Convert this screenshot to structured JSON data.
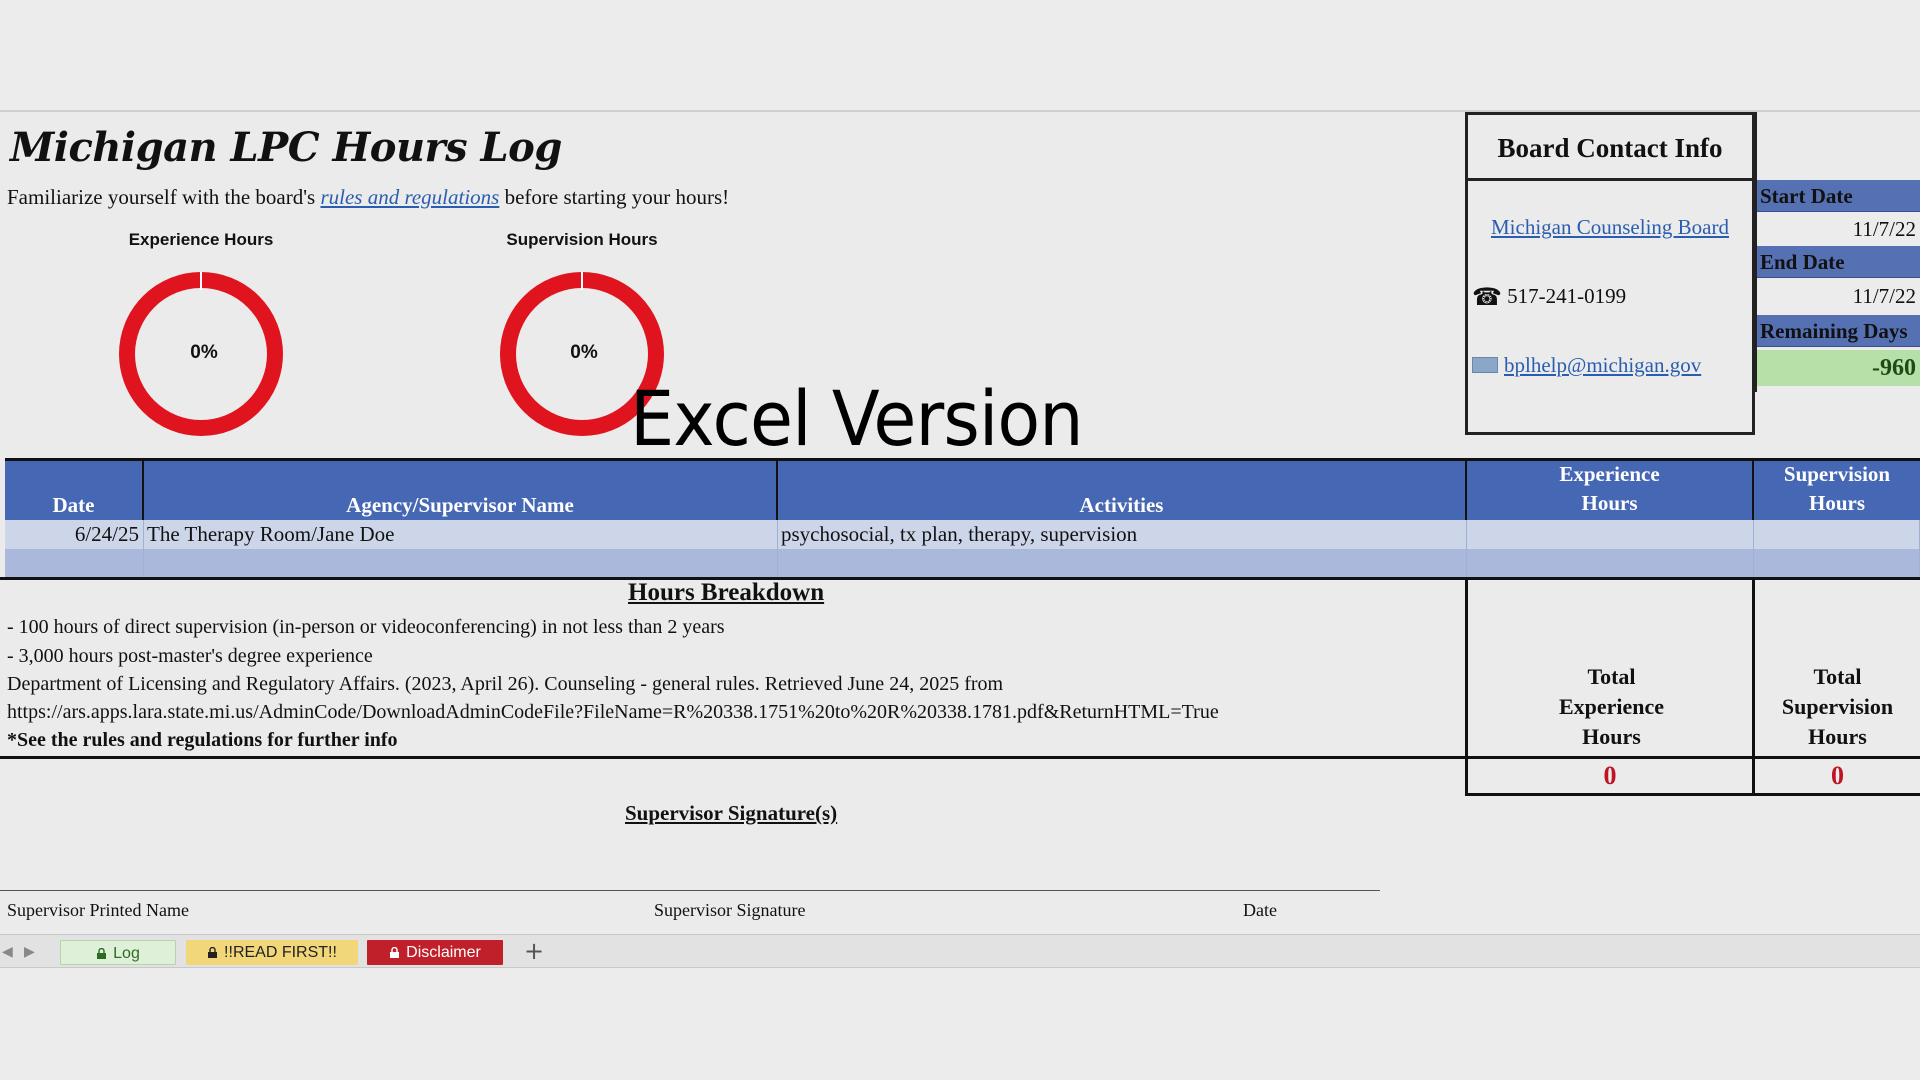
{
  "title": "Michigan LPC Hours Log",
  "intro": {
    "before": "Familiarize yourself with the board's ",
    "link": "rules and regulations",
    "after": " before starting your hours!"
  },
  "donuts": [
    {
      "title": "Experience Hours",
      "label": "0%",
      "percent": 0
    },
    {
      "title": "Supervision Hours",
      "label": "0%",
      "percent": 0
    }
  ],
  "watermark": "Excel Version",
  "contact": {
    "header": "Board Contact Info",
    "board_link": "Michigan Counseling Board",
    "phone": "517-241-0199",
    "email": "bplhelp@michigan.gov"
  },
  "dates": {
    "start_label": "Start Date",
    "start_value": "11/7/22",
    "end_label": "End Date",
    "end_value": "11/7/22",
    "remaining_label": "Remaining Days",
    "remaining_value": "-960"
  },
  "table": {
    "headers": {
      "date": "Date",
      "agency": "Agency/Supervisor Name",
      "activities": "Activities",
      "exp_line1": "Experience",
      "exp_line2": "Hours",
      "sup_line1": "Supervision",
      "sup_line2": "Hours"
    },
    "rows": [
      {
        "date": "6/24/25",
        "agency": "The Therapy Room/Jane Doe",
        "activities": "psychosocial, tx plan, therapy, supervision",
        "exp": "",
        "sup": ""
      }
    ]
  },
  "breakdown": {
    "title": "Hours Breakdown",
    "lines": [
      "- 100 hours of direct supervision (in-person or videoconferencing) in not less than 2 years",
      "- 3,000 hours post-master's degree experience",
      "Department of Licensing and Regulatory Affairs. (2023, April 26). Counseling - general rules. Retrieved June 24, 2025 from",
      "https://ars.apps.lara.state.mi.us/AdminCode/DownloadAdminCodeFile?FileName=R%20338.1751%20to%20R%20338.1781.pdf&ReturnHTML=True"
    ],
    "note": "*See the rules and regulations for further info"
  },
  "totals": {
    "exp_l1": "Total",
    "exp_l2": "Experience",
    "exp_l3": "Hours",
    "exp_value": "0",
    "sup_l1": "Total",
    "sup_l2": "Supervision",
    "sup_l3": "Hours",
    "sup_value": "0"
  },
  "signature": {
    "title": "Supervisor Signature(s)",
    "printed_name": "Supervisor Printed Name",
    "signature": "Supervisor Signature",
    "date": "Date"
  },
  "tabs": [
    {
      "label": "Log",
      "color": "#dff0d8"
    },
    {
      "label": "!!READ FIRST!!",
      "color": "#f2d77a"
    },
    {
      "label": "Disclaimer",
      "color": "#c0202a"
    }
  ],
  "colors": {
    "header_blue": "#4667b3",
    "donut_red": "#e0141e",
    "total_red": "#c01423"
  }
}
